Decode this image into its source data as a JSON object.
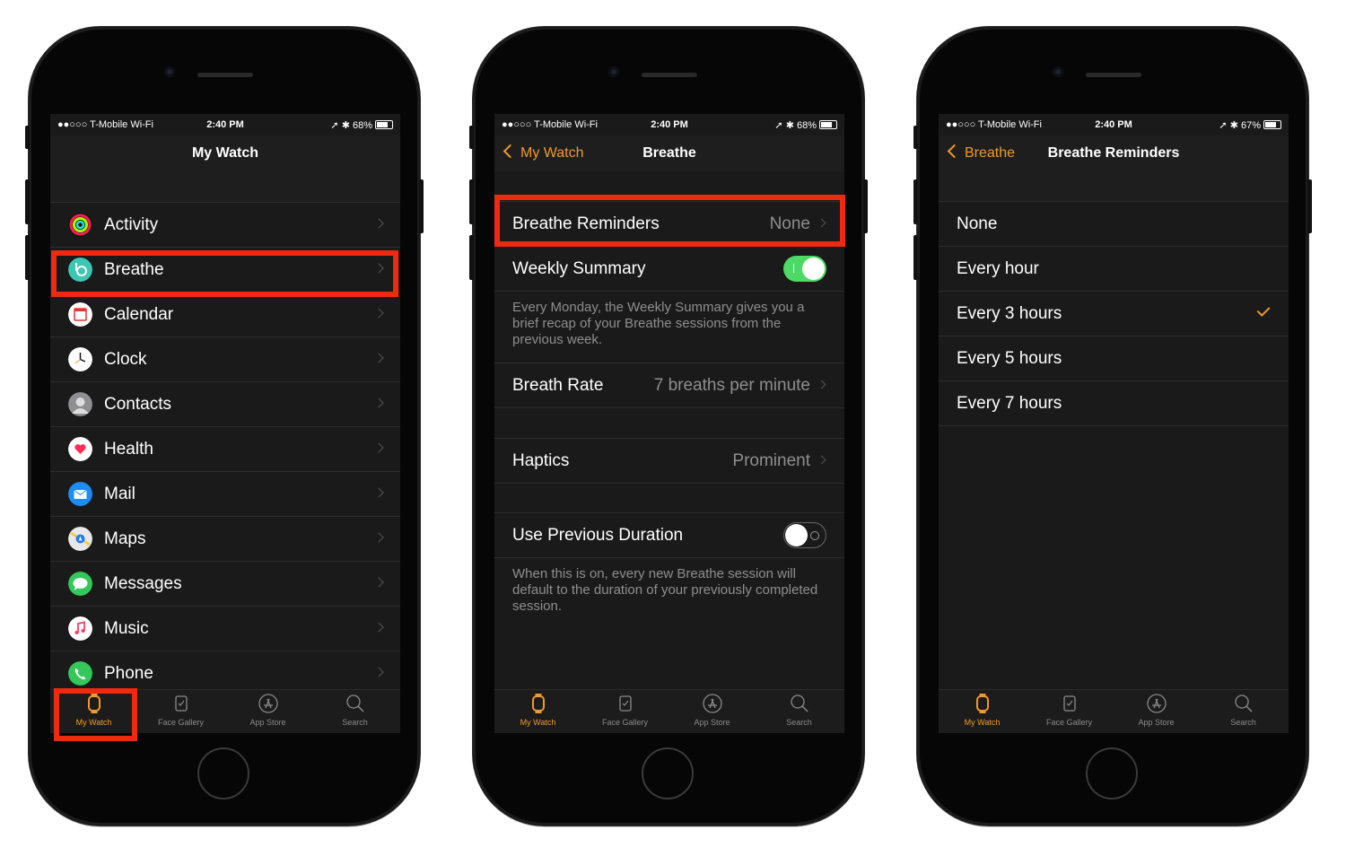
{
  "status_bars": [
    {
      "carrier": "●●○○○ T-Mobile Wi-Fi",
      "time": "2:40 PM",
      "battery": "68%"
    },
    {
      "carrier": "●●○○○ T-Mobile Wi-Fi",
      "time": "2:40 PM",
      "battery": "68%"
    },
    {
      "carrier": "●●○○○ T-Mobile Wi-Fi",
      "time": "2:40 PM",
      "battery": "67%"
    }
  ],
  "screen1": {
    "title": "My Watch",
    "apps": [
      {
        "label": "Activity",
        "icon": "activity-icon"
      },
      {
        "label": "Breathe",
        "icon": "breathe-icon"
      },
      {
        "label": "Calendar",
        "icon": "calendar-icon"
      },
      {
        "label": "Clock",
        "icon": "clock-icon"
      },
      {
        "label": "Contacts",
        "icon": "contacts-icon"
      },
      {
        "label": "Health",
        "icon": "health-icon"
      },
      {
        "label": "Mail",
        "icon": "mail-icon"
      },
      {
        "label": "Maps",
        "icon": "maps-icon"
      },
      {
        "label": "Messages",
        "icon": "messages-icon"
      },
      {
        "label": "Music",
        "icon": "music-icon"
      },
      {
        "label": "Phone",
        "icon": "phone-icon"
      }
    ]
  },
  "screen2": {
    "back": "My Watch",
    "title": "Breathe",
    "reminders": {
      "label": "Breathe Reminders",
      "value": "None"
    },
    "weekly": {
      "label": "Weekly Summary",
      "on": true
    },
    "weekly_desc": "Every Monday, the Weekly Summary gives you a brief recap of your Breathe sessions from the previous week.",
    "rate": {
      "label": "Breath Rate",
      "value": "7 breaths per minute"
    },
    "haptics": {
      "label": "Haptics",
      "value": "Prominent"
    },
    "duration": {
      "label": "Use Previous Duration",
      "on": false
    },
    "duration_desc": "When this is on, every new Breathe session will default to the duration of your previously completed session."
  },
  "screen3": {
    "back": "Breathe",
    "title": "Breathe Reminders",
    "options": [
      "None",
      "Every hour",
      "Every 3 hours",
      "Every 5 hours",
      "Every 7 hours"
    ],
    "selected": "Every 3 hours"
  },
  "tabs": [
    {
      "label": "My Watch",
      "icon": "my-watch-icon"
    },
    {
      "label": "Face Gallery",
      "icon": "face-gallery-icon"
    },
    {
      "label": "App Store",
      "icon": "app-store-icon"
    },
    {
      "label": "Search",
      "icon": "search-icon"
    }
  ],
  "colors": {
    "accent": "#f0992c",
    "highlight": "#ee2a10",
    "toggle_on": "#4cd964",
    "background": "#1a1a1a"
  }
}
